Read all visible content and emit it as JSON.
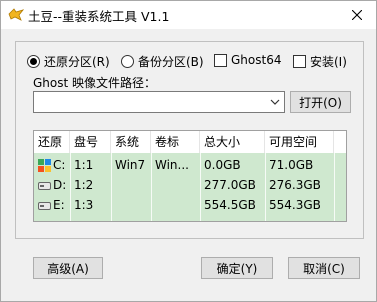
{
  "window": {
    "title": "土豆--重装系统工具 V1.1"
  },
  "options": {
    "restore_label": "还原分区(R)",
    "backup_label": "备份分区(B)",
    "ghost64_label": "Ghost64",
    "install_label": "安装(I)",
    "restore_selected": true
  },
  "path": {
    "label": "Ghost 映像文件路径：",
    "value": "",
    "open_label": "打开(O)"
  },
  "table": {
    "headers": [
      "还原",
      "盘号",
      "系统",
      "卷标",
      "总大小",
      "可用空间"
    ],
    "rows": [
      {
        "drive": "C:",
        "disk": "1:1",
        "system": "Win7",
        "volume": "Win...",
        "total": "0.0GB",
        "free": "71.0GB",
        "icon": "windows-drive-icon"
      },
      {
        "drive": "D:",
        "disk": "1:2",
        "system": "",
        "volume": "",
        "total": "277.0GB",
        "free": "276.3GB",
        "icon": "drive-icon"
      },
      {
        "drive": "E:",
        "disk": "1:3",
        "system": "",
        "volume": "",
        "total": "554.5GB",
        "free": "554.3GB",
        "icon": "drive-icon"
      }
    ]
  },
  "buttons": {
    "advanced": "高级(A)",
    "ok": "确定(Y)",
    "cancel": "取消(C)"
  },
  "colors": {
    "row_highlight": "#cfe8cf",
    "client_bg": "#f0f0f0"
  }
}
